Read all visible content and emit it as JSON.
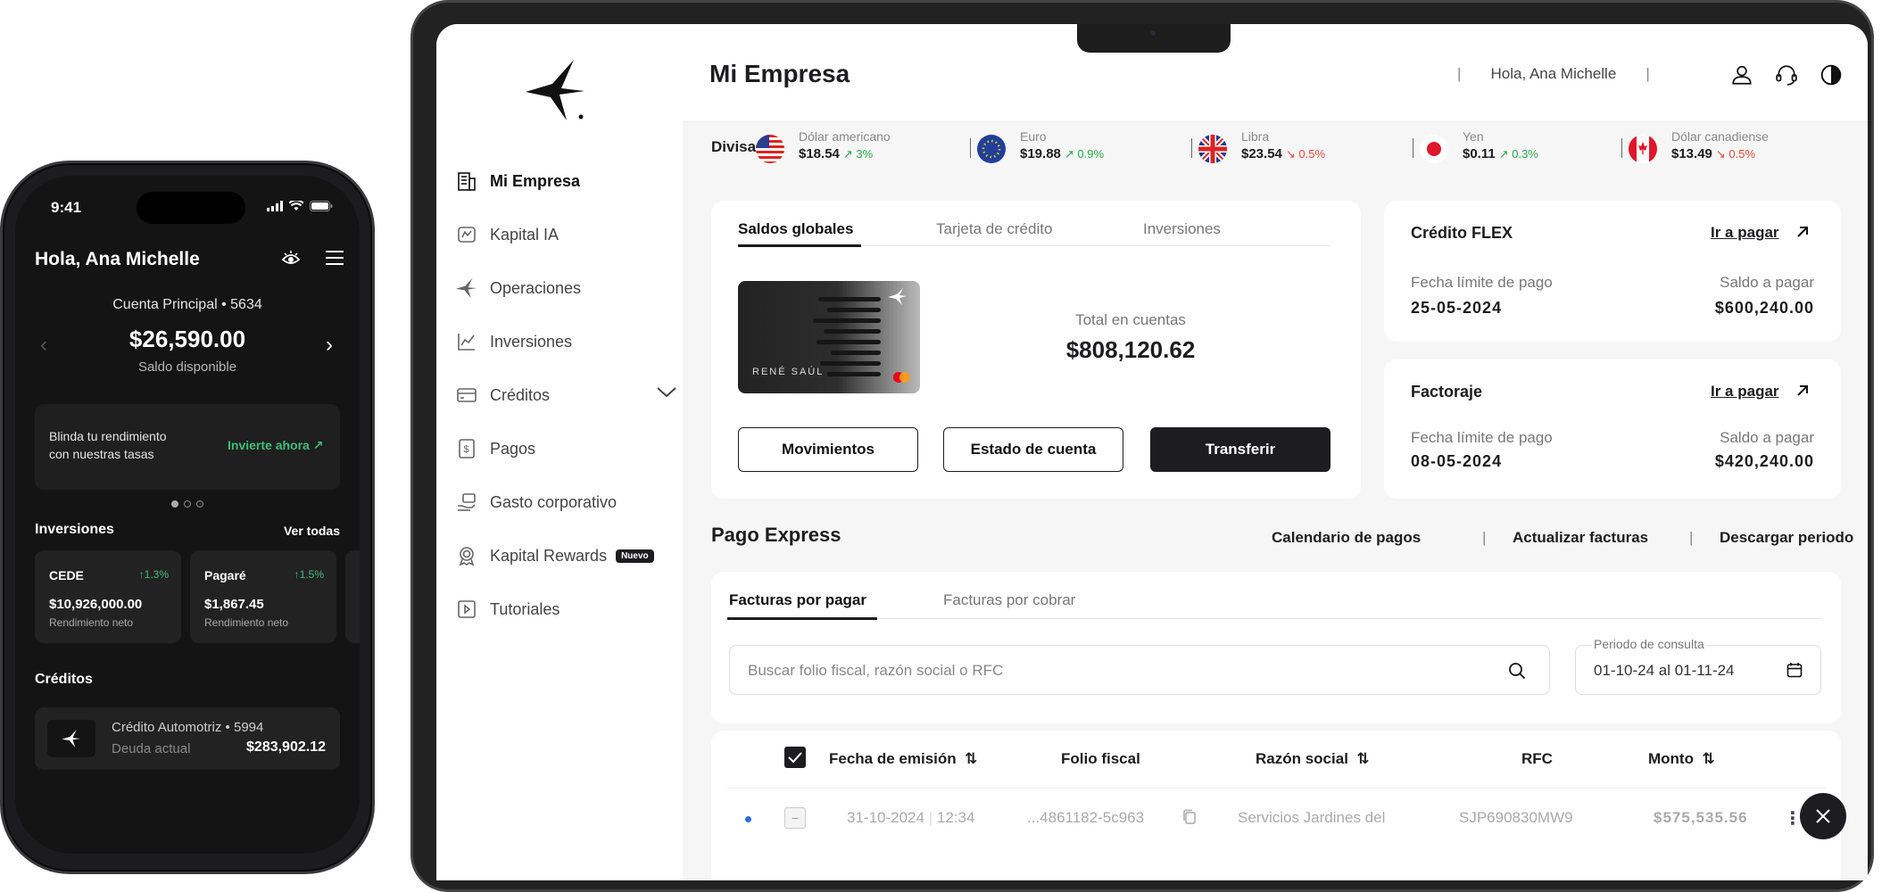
{
  "phone": {
    "time": "9:41",
    "greeting": "Hola, Ana Michelle",
    "account_label": "Cuenta Principal",
    "account_number": "• 5634",
    "balance": "$26,590.00",
    "balance_label": "Saldo disponible",
    "promo_text": "Blinda tu rendimiento con nuestras tasas",
    "promo_link": "Invierte ahora ↗",
    "investments_title": "Inversiones",
    "investments_link": "Ver todas",
    "investments": [
      {
        "name": "CEDE",
        "pct": "↑1.3%",
        "value": "$10,926,000.00",
        "sub": "Rendimiento neto"
      },
      {
        "name": "Pagaré",
        "pct": "↑1.5%",
        "value": "$1,867.45",
        "sub": "Rendimiento neto"
      }
    ],
    "credits_title": "Créditos",
    "credit": {
      "name": "Crédito Automotriz • 5994",
      "debt_label": "Deuda actual",
      "debt": "$283,902.12"
    }
  },
  "sidebar": {
    "items": [
      {
        "label": "Mi Empresa",
        "icon": "building-icon"
      },
      {
        "label": "Kapital IA",
        "icon": "ai-icon"
      },
      {
        "label": "Operaciones",
        "icon": "operations-icon"
      },
      {
        "label": "Inversiones",
        "icon": "chart-line-icon"
      },
      {
        "label": "Créditos",
        "icon": "credit-card-icon"
      },
      {
        "label": "Pagos",
        "icon": "payments-icon"
      },
      {
        "label": "Gasto corporativo",
        "icon": "corporate-expense-icon"
      },
      {
        "label": "Kapital Rewards",
        "icon": "rewards-icon",
        "badge": "Nuevo"
      },
      {
        "label": "Tutoriales",
        "icon": "tutorials-icon"
      }
    ]
  },
  "header": {
    "title": "Mi Empresa",
    "greeting": "Hola, Ana Michelle"
  },
  "currencies": {
    "label": "Divisas",
    "items": [
      {
        "name": "Dólar americano",
        "value": "$18.54",
        "change": "3%",
        "dir": "up"
      },
      {
        "name": "Euro",
        "value": "$19.88",
        "change": "0.9%",
        "dir": "up"
      },
      {
        "name": "Libra",
        "value": "$23.54",
        "change": "0.5%",
        "dir": "down"
      },
      {
        "name": "Yen",
        "value": "$0.11",
        "change": "0.3%",
        "dir": "up"
      },
      {
        "name": "Dólar canadiense",
        "value": "$13.49",
        "change": "0.5%",
        "dir": "down"
      }
    ]
  },
  "balances": {
    "tabs": [
      "Saldos globales",
      "Tarjeta de crédito",
      "Inversiones"
    ],
    "card_holder": "RENÉ SAÚL",
    "total_label": "Total en cuentas",
    "total": "$808,120.62",
    "buttons": [
      "Movimientos",
      "Estado de cuenta",
      "Transferir"
    ]
  },
  "credit_flex": {
    "title": "Crédito FLEX",
    "link": "Ir a pagar",
    "due_label": "Fecha límite de pago",
    "due": "25-05-2024",
    "amount_label": "Saldo a pagar",
    "amount": "$600,240.00"
  },
  "factoraje": {
    "title": "Factoraje",
    "link": "Ir a pagar",
    "due_label": "Fecha límite de pago",
    "due": "08-05-2024",
    "amount_label": "Saldo a pagar",
    "amount": "$420,240.00"
  },
  "express": {
    "title": "Pago Express",
    "actions": [
      "Calendario de pagos",
      "Actualizar facturas",
      "Descargar periodo"
    ],
    "tabs": [
      "Facturas por pagar",
      "Facturas por cobrar"
    ],
    "search_placeholder": "Buscar folio fiscal, razón social o RFC",
    "period_label": "Periodo de consulta",
    "period_value": "01-10-24 al 01-11-24",
    "columns": [
      "Fecha de emisión",
      "Folio fiscal",
      "Razón social",
      "RFC",
      "Monto"
    ],
    "row": {
      "date": "31-10-2024",
      "time": "12:34",
      "folio": "...4861182-5c963",
      "company": "Servicios Jardines del",
      "rfc": "SJP690830MW9",
      "amount": "$575,535.56"
    }
  },
  "colors": {
    "accent": "#1d1d1f",
    "up": "#2ba84a",
    "down": "#e24b3b",
    "promo": "#3fbf7a"
  }
}
